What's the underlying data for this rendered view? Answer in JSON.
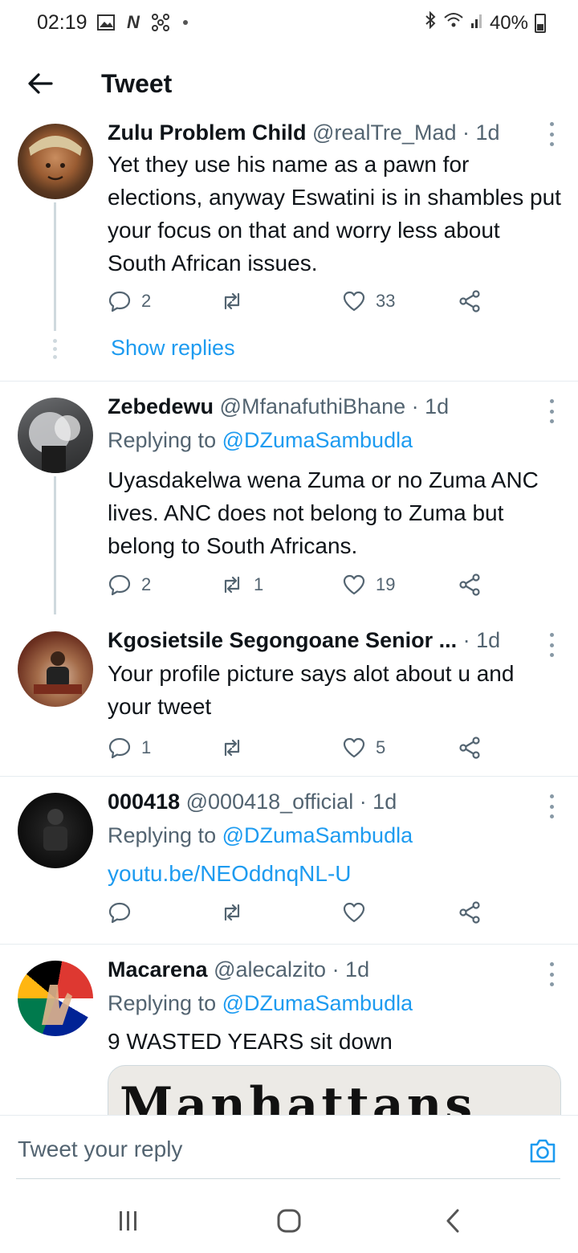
{
  "status_bar": {
    "time": "02:19",
    "battery": "40%",
    "left_icons": [
      "gallery-icon",
      "netflix-icon",
      "hub-icon"
    ],
    "right_icons": [
      "bluetooth-icon",
      "wifi-icon",
      "signal-icon",
      "battery-icon"
    ]
  },
  "header": {
    "title": "Tweet"
  },
  "tweets": [
    {
      "name": "Zulu Problem Child",
      "handle": "@realTre_Mad · 1d",
      "text": "Yet they use his name as a pawn for elections, anyway Eswatini is in shambles put your focus on that and worry less about South African issues.",
      "replies": "2",
      "retweets": "",
      "likes": "33",
      "show_replies": "Show replies"
    },
    {
      "name": "Zebedewu",
      "handle": "@MfanafuthiBhane · 1d",
      "replying_label": "Replying to ",
      "replying_to": "@DZumaSambudla",
      "text": "Uyasdakelwa wena Zuma or no Zuma ANC lives. ANC does not belong to Zuma but belong to South Africans.",
      "replies": "2",
      "retweets": "1",
      "likes": "19"
    },
    {
      "name": "Kgosietsile Segongoane Senior ...",
      "handle": " · 1d",
      "text": "Your profile picture says alot about u and your tweet",
      "replies": "1",
      "retweets": "",
      "likes": "5"
    },
    {
      "name": "000418",
      "handle": "@000418_official · 1d",
      "replying_label": "Replying to ",
      "replying_to": "@DZumaSambudla",
      "link": "youtu.be/NEOddnqNL-U",
      "replies": "",
      "retweets": "",
      "likes": ""
    },
    {
      "name": "Macarena",
      "handle": "@alecalzito · 1d",
      "replying_label": "Replying to ",
      "replying_to": "@DZumaSambudla",
      "text": "9 WASTED YEARS sit down",
      "media_text": "Manhattans"
    }
  ],
  "reply_bar": {
    "placeholder": "Tweet your reply"
  },
  "colors": {
    "link": "#1d9bf0",
    "secondary": "#536471",
    "divider": "#e6ecf0"
  }
}
